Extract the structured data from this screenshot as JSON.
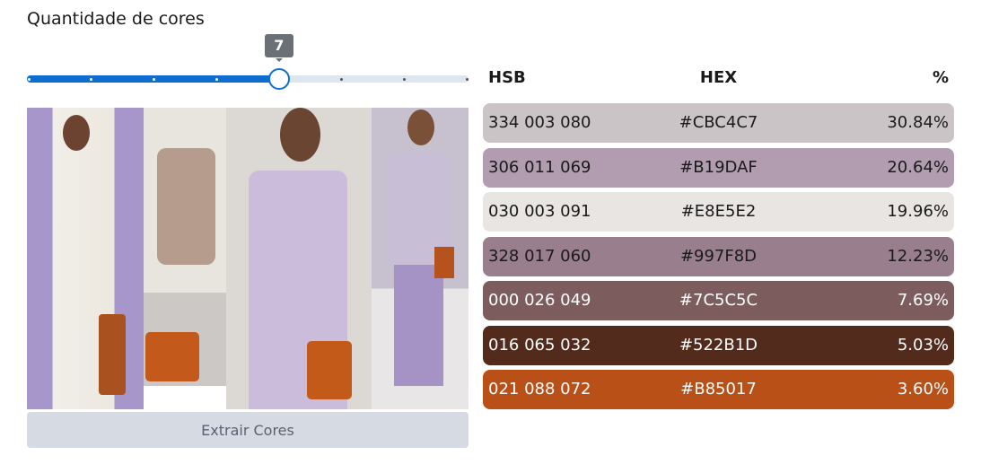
{
  "title": "Quantidade de cores",
  "slider": {
    "min": 3,
    "max": 10,
    "value": 7,
    "label": "7"
  },
  "button": {
    "label": "Extrair Cores"
  },
  "table": {
    "headers": [
      "HSB",
      "HEX",
      "%"
    ],
    "rows": [
      {
        "hsb": "334 003 080",
        "hex": "#CBC4C7",
        "pct": "30.84%",
        "color": "#CBC4C7",
        "text": "#1a1a1a"
      },
      {
        "hsb": "306 011 069",
        "hex": "#B19DAF",
        "pct": "20.64%",
        "color": "#B19DAF",
        "text": "#1a1a1a"
      },
      {
        "hsb": "030 003 091",
        "hex": "#E8E5E2",
        "pct": "19.96%",
        "color": "#E8E5E2",
        "text": "#1a1a1a"
      },
      {
        "hsb": "328 017 060",
        "hex": "#997F8D",
        "pct": "12.23%",
        "color": "#997F8D",
        "text": "#1a1a1a"
      },
      {
        "hsb": "000 026 049",
        "hex": "#7C5C5C",
        "pct": "7.69%",
        "color": "#7C5C5C",
        "text": "#ffffff"
      },
      {
        "hsb": "016 065 032",
        "hex": "#522B1D",
        "pct": "5.03%",
        "color": "#522B1D",
        "text": "#ffffff"
      },
      {
        "hsb": "021 088 072",
        "hex": "#B85017",
        "pct": "3.60%",
        "color": "#B85017",
        "text": "#ffffff"
      }
    ]
  }
}
